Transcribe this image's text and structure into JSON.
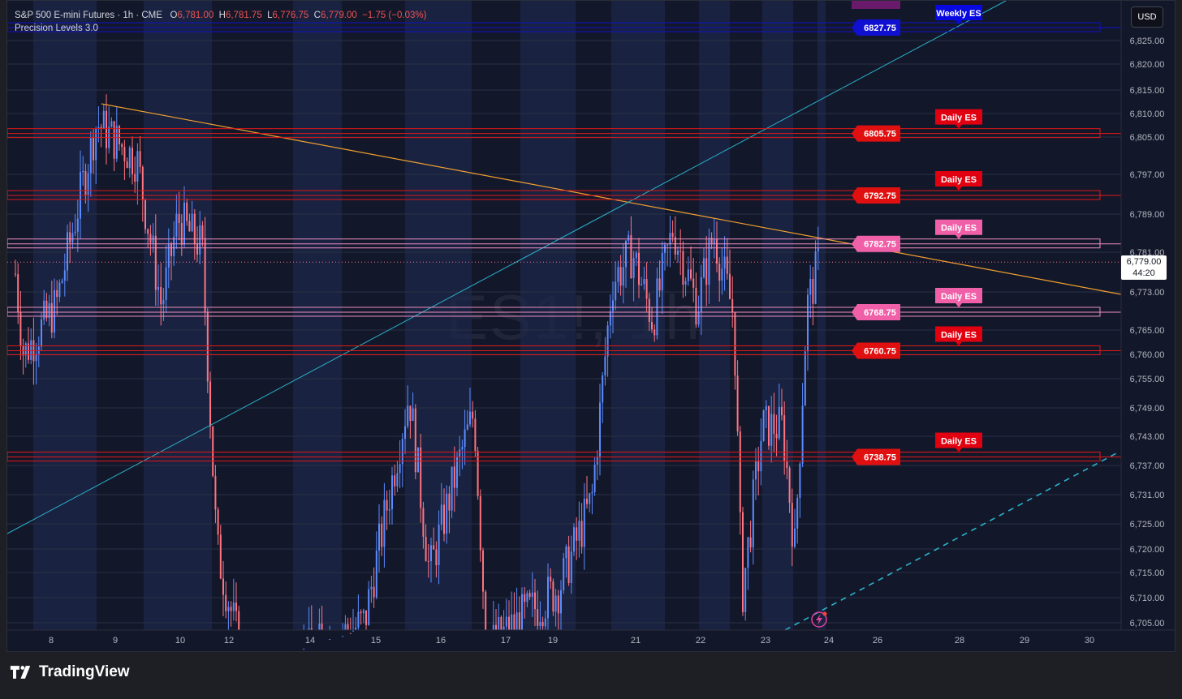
{
  "legend": {
    "symbol": "S&P 500 E-mini Futures · 1h · CME",
    "open_label": "O",
    "open": "6,781.00",
    "high_label": "H",
    "high": "6,781.75",
    "low_label": "L",
    "low": "6,776.75",
    "close_label": "C",
    "close": "6,779.00",
    "change": "−1.75 (−0.03%)",
    "indicator": "Precision Levels 3.0"
  },
  "currency_button": "USD",
  "current_price": {
    "price": "6,779.00",
    "countdown": "44:20"
  },
  "watermark": "ES1!, 1h",
  "brand": "TradingView",
  "colors": {
    "background": "#131722",
    "bull": "#5b8cff",
    "bear": "#ff7480",
    "level_red": "#e01818",
    "level_pink": "#f060a8",
    "level_blue": "#1010d0",
    "trend_orange": "#f0a030",
    "trend_cyan": "#2ab0c8"
  },
  "chart_data": {
    "type": "candlestick",
    "title": "S&P 500 E-mini Futures · 1h · CME",
    "y_axis_ticks": [
      6825,
      6820,
      6815,
      6810,
      6805,
      6797,
      6789,
      6781,
      6773,
      6765,
      6760,
      6755,
      6749,
      6743,
      6737,
      6731,
      6725,
      6720,
      6715,
      6710,
      6705
    ],
    "y_axis_labels": [
      "6,825.00",
      "6,820.00",
      "6,815.00",
      "6,810.00",
      "6,805.00",
      "6,797.00",
      "6,789.00",
      "6,781.00",
      "6,773.00",
      "6,765.00",
      "6,760.00",
      "6,755.00",
      "6,749.00",
      "6,743.00",
      "6,737.00",
      "6,731.00",
      "6,725.00",
      "6,720.00",
      "6,715.00",
      "6,710.00",
      "6,705.00"
    ],
    "x_axis_labels": [
      "8",
      "9",
      "10",
      "12",
      "14",
      "15",
      "16",
      "17",
      "19",
      "21",
      "22",
      "23",
      "24",
      "26",
      "28",
      "29",
      "30"
    ],
    "levels": [
      {
        "price": 6827.75,
        "label": "6827.75",
        "tag": "Weekly ES",
        "style": "blue"
      },
      {
        "price": 6805.75,
        "label": "6805.75",
        "tag": "Daily ES",
        "style": "red"
      },
      {
        "price": 6792.75,
        "label": "6792.75",
        "tag": "Daily ES",
        "style": "red"
      },
      {
        "price": 6782.75,
        "label": "6782.75",
        "tag": "Daily ES",
        "style": "pink"
      },
      {
        "price": 6768.75,
        "label": "6768.75",
        "tag": "Daily ES",
        "style": "pink"
      },
      {
        "price": 6760.75,
        "label": "6760.75",
        "tag": "Daily ES",
        "style": "red"
      },
      {
        "price": 6738.75,
        "label": "6738.75",
        "tag": "Daily ES",
        "style": "red"
      }
    ],
    "last_price": 6779.0
  }
}
